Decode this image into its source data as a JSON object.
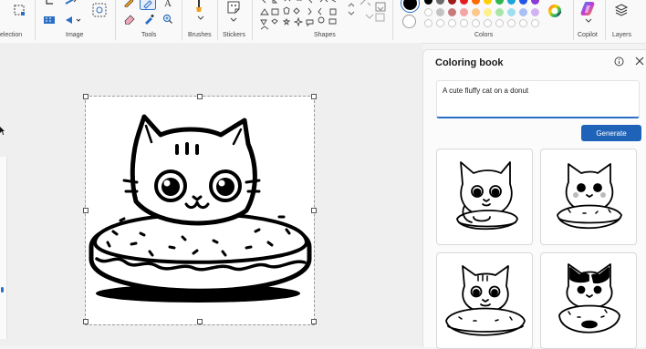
{
  "ribbon": {
    "groups": {
      "selection": "election",
      "image": "Image",
      "tools": "Tools",
      "brushes": "Brushes",
      "stickers": "Stickers",
      "shapes": "Shapes",
      "colors": "Colors",
      "copilot": "Copilot",
      "layers": "Layers"
    },
    "colors": {
      "primary": "#000000",
      "secondary": "#ffffff",
      "row1": [
        "#000000",
        "#6b6b6b",
        "#9d1c1c",
        "#e02020",
        "#ff6a00",
        "#ffd000",
        "#2db84d",
        "#1aa6d6",
        "#2456e8",
        "#8a3ad6"
      ],
      "row2": [
        "#ffffff",
        "#c3c3c3",
        "#c87a7a",
        "#f3a4a4",
        "#ffc78a",
        "#fff08a",
        "#a8e6a8",
        "#9edff2",
        "#a9bff5",
        "#d2b2f2"
      ]
    }
  },
  "panel": {
    "title": "Coloring book",
    "prompt": "A cute fluffy cat on a donut",
    "generate_label": "Generate"
  }
}
